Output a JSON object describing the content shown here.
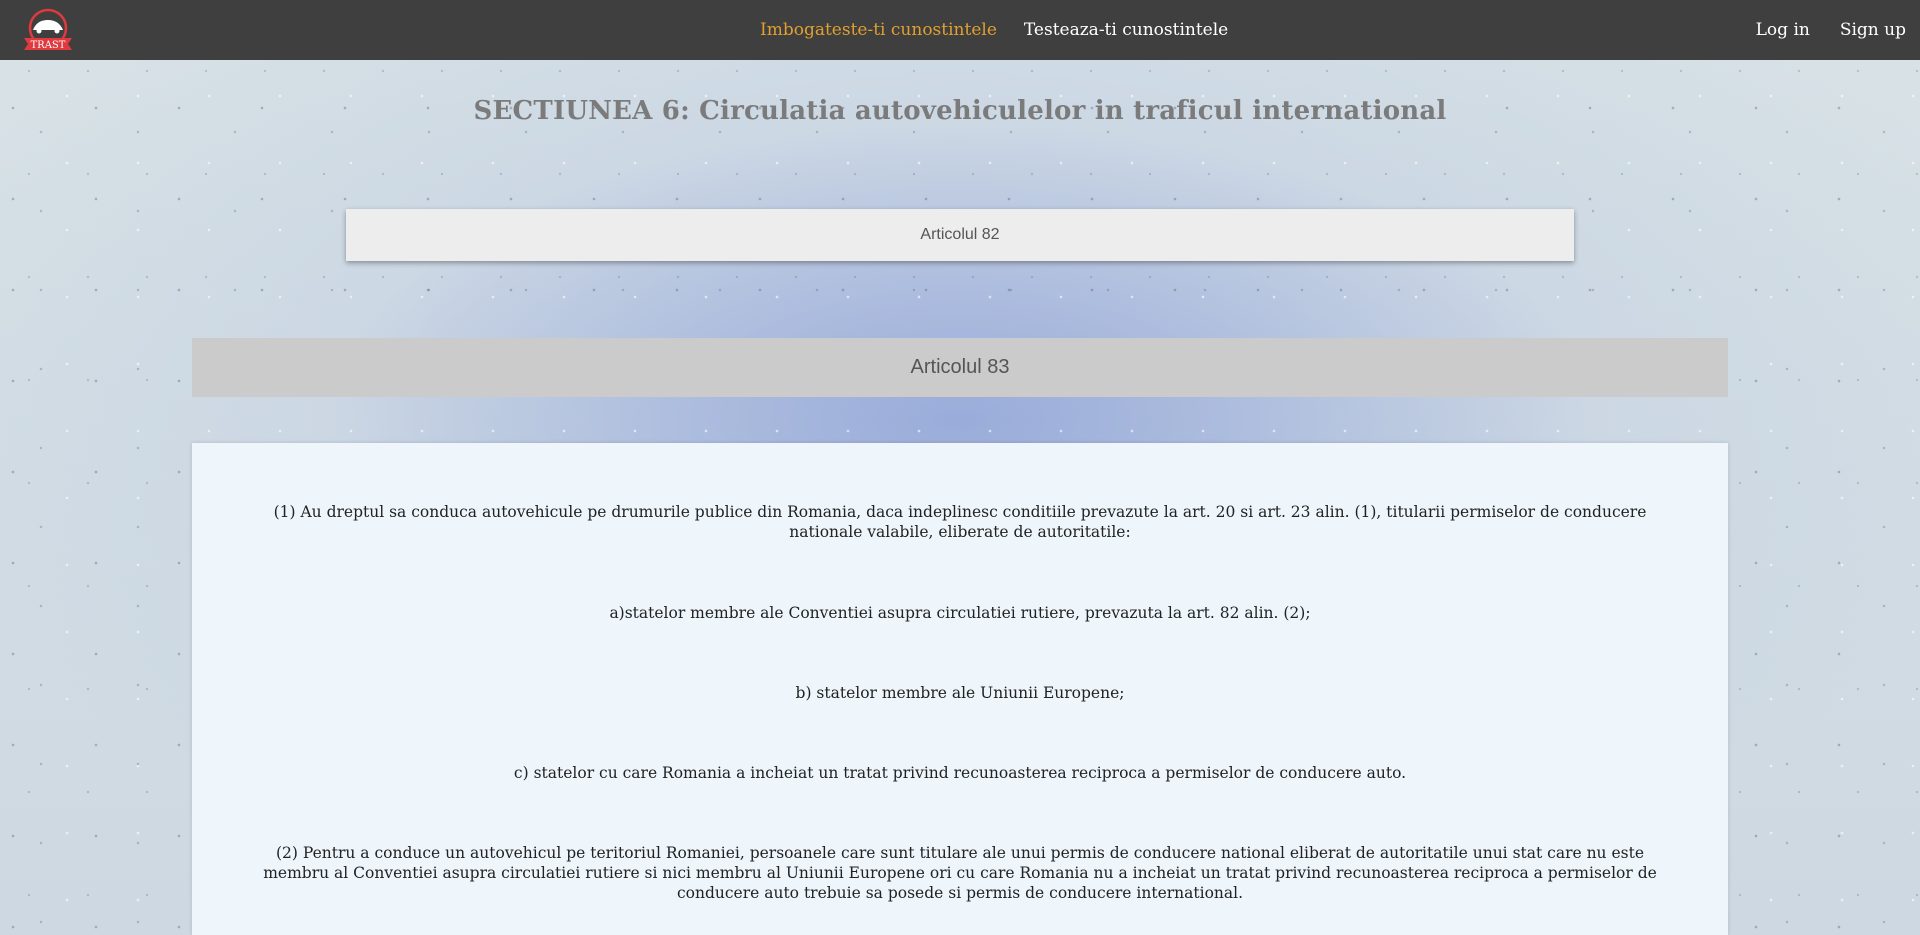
{
  "navbar": {
    "logo_text": "TRAST",
    "links": [
      {
        "label": "Imbogateste-ti cunostintele",
        "active": true
      },
      {
        "label": "Testeaza-ti cunostintele",
        "active": false
      }
    ],
    "login_label": "Log in",
    "signup_label": "Sign up"
  },
  "section": {
    "title": "SECTIUNEA 6: Circulatia autovehiculelor in traficul international"
  },
  "articles": {
    "collapsed": {
      "label": "Articolul 82"
    },
    "expanded": {
      "label": "Articolul 83",
      "paragraphs": [
        "(1) Au dreptul sa conduca autovehicule pe drumurile publice din Romania, daca indeplinesc conditiile prevazute la art. 20 si art. 23 alin. (1), titularii permiselor de conducere nationale valabile, eliberate de autoritatile:",
        "a)statelor membre ale Conventiei asupra circulatiei rutiere, prevazuta la art. 82 alin. (2);",
        "b) statelor membre ale Uniunii Europene;",
        "c) statelor cu care Romania a incheiat un tratat privind recunoasterea reciproca a permiselor de conducere auto.",
        "(2) Pentru a conduce un autovehicul pe teritoriul Romaniei, persoanele care sunt titulare ale unui permis de conducere national eliberat de autoritatile unui stat care nu este membru al Conventiei asupra circulatiei rutiere si nici membru al Uniunii Europene ori cu care Romania nu a incheiat un tratat privind recunoasterea reciproca a permiselor de conducere auto trebuie sa posede si permis de conducere international."
      ]
    }
  },
  "colors": {
    "navbar_bg": "#3f3f3f",
    "active_link": "#e0a030",
    "logo_red": "#e0393e"
  }
}
